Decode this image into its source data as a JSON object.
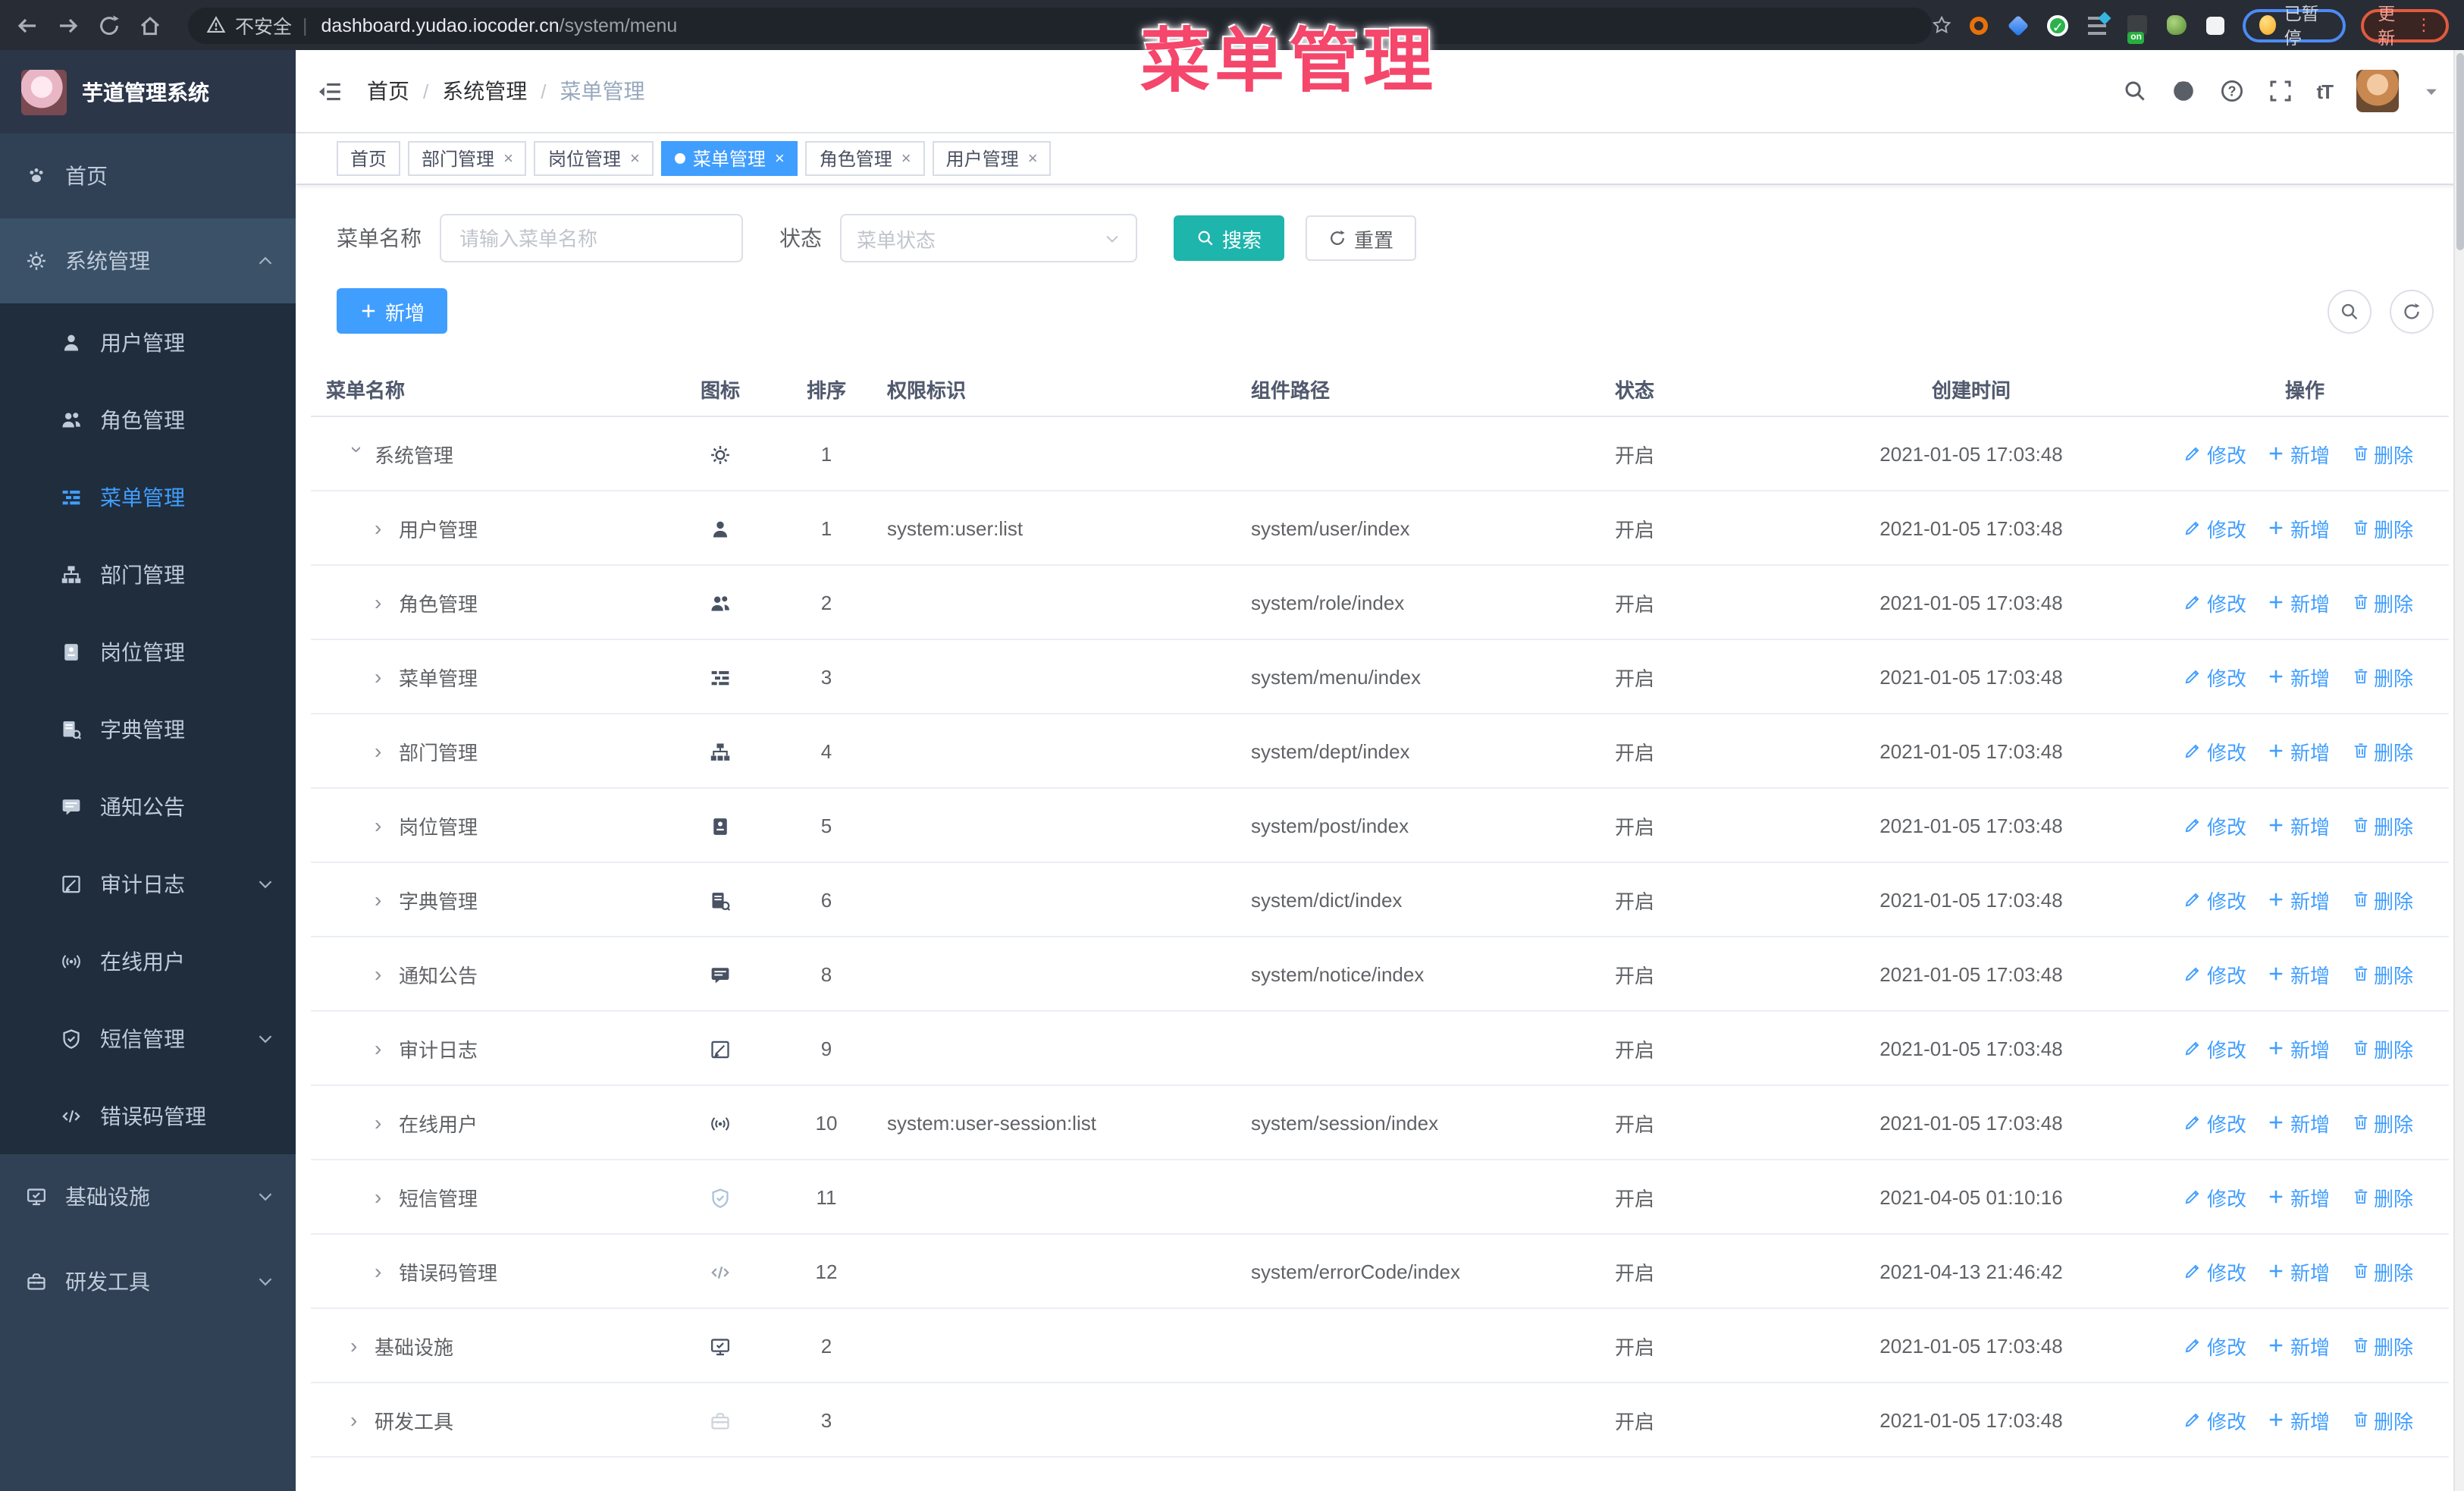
{
  "browser": {
    "security_label": "不安全",
    "url_host": "dashboard.yudao.iocoder.cn",
    "url_path": "/system/menu",
    "paused_badge": "已暂停",
    "update_button": "更新",
    "extension_on_badge": "on"
  },
  "overlay_title": "菜单管理",
  "glyphs": {
    "close": "×",
    "row_arrow": "›",
    "breadcrumb_sep": "/",
    "url_sep": "|",
    "ellipsis": "⋮"
  },
  "colors": {
    "accent_blue": "#409eff",
    "search_teal": "#1eb5ac",
    "sidebar_bg": "#304156",
    "submenu_bg": "#1f2d3d",
    "overlay_pink": "#f5466b",
    "active_link": "#409eff"
  },
  "sidebar": {
    "logo_title": "芋道管理系统",
    "items": [
      {
        "label": "首页",
        "icon": "dashboard",
        "level": 0
      },
      {
        "label": "系统管理",
        "icon": "gear",
        "level": 0,
        "open": true,
        "chevron": "up"
      },
      {
        "label": "用户管理",
        "icon": "user",
        "level": 1
      },
      {
        "label": "角色管理",
        "icon": "peoples",
        "level": 1
      },
      {
        "label": "菜单管理",
        "icon": "tree-table",
        "level": 1,
        "active": true
      },
      {
        "label": "部门管理",
        "icon": "tree",
        "level": 1
      },
      {
        "label": "岗位管理",
        "icon": "post",
        "level": 1
      },
      {
        "label": "字典管理",
        "icon": "dict",
        "level": 1
      },
      {
        "label": "通知公告",
        "icon": "message",
        "level": 1
      },
      {
        "label": "审计日志",
        "icon": "log",
        "level": 1,
        "chevron": "down"
      },
      {
        "label": "在线用户",
        "icon": "online",
        "level": 1
      },
      {
        "label": "短信管理",
        "icon": "shield",
        "level": 1,
        "chevron": "down"
      },
      {
        "label": "错误码管理",
        "icon": "code",
        "level": 1
      },
      {
        "label": "基础设施",
        "icon": "monitor",
        "level": 0,
        "chevron": "down"
      },
      {
        "label": "研发工具",
        "icon": "toolbox",
        "level": 0,
        "chevron": "down"
      }
    ]
  },
  "header": {
    "breadcrumb": [
      "首页",
      "系统管理",
      "菜单管理"
    ]
  },
  "tabs": [
    {
      "label": "首页",
      "closable": false,
      "active": false
    },
    {
      "label": "部门管理",
      "closable": true,
      "active": false
    },
    {
      "label": "岗位管理",
      "closable": true,
      "active": false
    },
    {
      "label": "菜单管理",
      "closable": true,
      "active": true
    },
    {
      "label": "角色管理",
      "closable": true,
      "active": false
    },
    {
      "label": "用户管理",
      "closable": true,
      "active": false
    }
  ],
  "filters": {
    "name_label": "菜单名称",
    "name_placeholder": "请输入菜单名称",
    "status_label": "状态",
    "status_placeholder": "菜单状态",
    "search_label": "搜索",
    "reset_label": "重置"
  },
  "toolbar": {
    "add_label": "新增"
  },
  "table": {
    "columns": [
      "菜单名称",
      "图标",
      "排序",
      "权限标识",
      "组件路径",
      "状态",
      "创建时间",
      "操作"
    ],
    "actions": {
      "modify": "修改",
      "add": "新增",
      "delete": "删除"
    },
    "rows": [
      {
        "name": "系统管理",
        "level": 0,
        "expanded": true,
        "icon": "gear",
        "sort": "1",
        "perm": "",
        "path": "",
        "status": "开启",
        "time": "2021-01-05 17:03:48"
      },
      {
        "name": "用户管理",
        "level": 1,
        "expanded": false,
        "icon": "user",
        "sort": "1",
        "perm": "system:user:list",
        "path": "system/user/index",
        "status": "开启",
        "time": "2021-01-05 17:03:48"
      },
      {
        "name": "角色管理",
        "level": 1,
        "expanded": false,
        "icon": "peoples",
        "sort": "2",
        "perm": "",
        "path": "system/role/index",
        "status": "开启",
        "time": "2021-01-05 17:03:48"
      },
      {
        "name": "菜单管理",
        "level": 1,
        "expanded": false,
        "icon": "tree-table",
        "sort": "3",
        "perm": "",
        "path": "system/menu/index",
        "status": "开启",
        "time": "2021-01-05 17:03:48"
      },
      {
        "name": "部门管理",
        "level": 1,
        "expanded": false,
        "icon": "tree",
        "sort": "4",
        "perm": "",
        "path": "system/dept/index",
        "status": "开启",
        "time": "2021-01-05 17:03:48"
      },
      {
        "name": "岗位管理",
        "level": 1,
        "expanded": false,
        "icon": "post",
        "sort": "5",
        "perm": "",
        "path": "system/post/index",
        "status": "开启",
        "time": "2021-01-05 17:03:48"
      },
      {
        "name": "字典管理",
        "level": 1,
        "expanded": false,
        "icon": "dict",
        "sort": "6",
        "perm": "",
        "path": "system/dict/index",
        "status": "开启",
        "time": "2021-01-05 17:03:48"
      },
      {
        "name": "通知公告",
        "level": 1,
        "expanded": false,
        "icon": "message",
        "sort": "8",
        "perm": "",
        "path": "system/notice/index",
        "status": "开启",
        "time": "2021-01-05 17:03:48"
      },
      {
        "name": "审计日志",
        "level": 1,
        "expanded": false,
        "icon": "log",
        "sort": "9",
        "perm": "",
        "path": "",
        "status": "开启",
        "time": "2021-01-05 17:03:48"
      },
      {
        "name": "在线用户",
        "level": 1,
        "expanded": false,
        "icon": "online",
        "sort": "10",
        "perm": "system:user-session:list",
        "path": "system/session/index",
        "status": "开启",
        "time": "2021-01-05 17:03:48"
      },
      {
        "name": "短信管理",
        "level": 1,
        "expanded": false,
        "icon": "shield",
        "sort": "11",
        "perm": "",
        "path": "",
        "status": "开启",
        "time": "2021-04-05 01:10:16",
        "icon_color": "#a9c3dc"
      },
      {
        "name": "错误码管理",
        "level": 1,
        "expanded": false,
        "icon": "code",
        "sort": "12",
        "perm": "",
        "path": "system/errorCode/index",
        "status": "开启",
        "time": "2021-04-13 21:46:42",
        "icon_color": "#9aa1ad"
      },
      {
        "name": "基础设施",
        "level": 0,
        "expanded": false,
        "icon": "monitor",
        "sort": "2",
        "perm": "",
        "path": "",
        "status": "开启",
        "time": "2021-01-05 17:03:48"
      },
      {
        "name": "研发工具",
        "level": 0,
        "expanded": false,
        "icon": "toolbox",
        "sort": "3",
        "perm": "",
        "path": "",
        "status": "开启",
        "time": "2021-01-05 17:03:48",
        "icon_color": "#cfd3da"
      }
    ]
  }
}
